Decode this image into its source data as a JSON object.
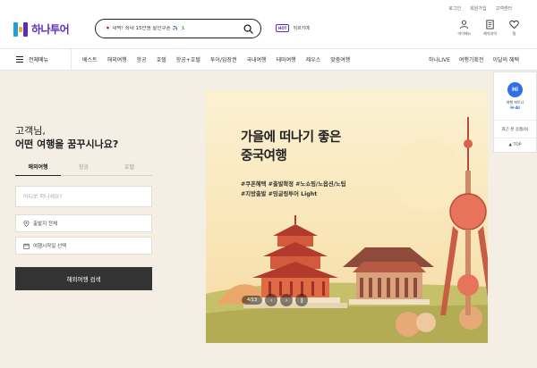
{
  "util": {
    "login": "로그인",
    "join": "회원가입",
    "help": "고객센터"
  },
  "brand": {
    "name": "하나투어",
    "color": "#5e2bb8"
  },
  "search": {
    "placeholder": "🇯🇵 대박! 최대 15만원 할인쿠폰 ✈️ 🏃‍♂️"
  },
  "hot": {
    "badge": "HOT",
    "label": "뒤르키예"
  },
  "header_icons": [
    {
      "label": "마이메뉴",
      "icon": "person-icon"
    },
    {
      "label": "예약내역",
      "icon": "document-icon"
    },
    {
      "label": "찜",
      "icon": "heart-icon"
    }
  ],
  "nav": {
    "all": "전체메뉴",
    "items": [
      "베스트",
      "해외여행",
      "항공",
      "호텔",
      "항공+호텔",
      "투어/입장권",
      "국내여행",
      "테마여행",
      "제우스",
      "맞춤여행"
    ],
    "right": [
      "하나LIVE",
      "여행기획전",
      "이달의 혜택"
    ]
  },
  "greeting": {
    "line1": "고객님,",
    "line2": "어떤 여행을 꿈꾸시나요?"
  },
  "search_tabs": [
    "해외여행",
    "항공",
    "호텔"
  ],
  "search_form": {
    "destination_placeholder": "어디로 떠나세요?",
    "departure": "출발지 전체",
    "date": "여행시작일 선택",
    "submit": "해외여행 검색"
  },
  "banner": {
    "title_line1": "가을에 떠나기 좋은",
    "title_line2": "중국여행",
    "tags_line1": "#쿠폰혜택 #출발확정 #노쇼핑/노옵션/노팁",
    "tags_line2": "#지방출발 #밍글링투어 Light",
    "page": "4/13"
  },
  "side": {
    "ai_badge": "Hi",
    "ai_line1": "여행 파트너",
    "ai_line2": "H-AI",
    "recent": "최근 본 상품(0)",
    "top": "▲ TOP"
  },
  "colors": {
    "main_bg": "#f4eee4",
    "ai_blue": "#2f6fe8",
    "button_dark": "#333333"
  }
}
